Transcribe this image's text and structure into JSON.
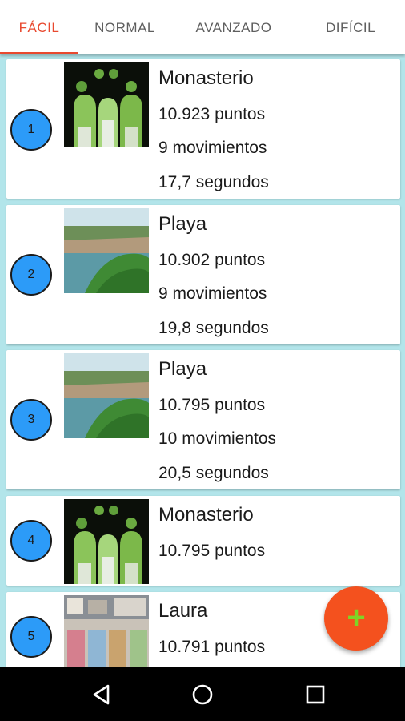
{
  "tabs": [
    {
      "label": "FÁCIL",
      "active": true
    },
    {
      "label": "NORMAL",
      "active": false
    },
    {
      "label": "AVANZADO",
      "active": false
    },
    {
      "label": "DIFÍCIL",
      "active": false
    }
  ],
  "colors": {
    "accent": "#e8492f",
    "rank_badge": "#2c9bf8",
    "fab": "#f4511e",
    "fab_icon": "#7fd426",
    "list_background": "#b2e5ea"
  },
  "scores": [
    {
      "rank": "1",
      "puzzle": "Monasterio",
      "image": "monastery",
      "points": "10.923 puntos",
      "moves": "9 movimientos",
      "time": "17,7 segundos"
    },
    {
      "rank": "2",
      "puzzle": "Playa",
      "image": "beach",
      "points": "10.902 puntos",
      "moves": "9 movimientos",
      "time": "19,8 segundos"
    },
    {
      "rank": "3",
      "puzzle": "Playa",
      "image": "beach",
      "points": "10.795 puntos",
      "moves": "10 movimientos",
      "time": "20,5 segundos"
    },
    {
      "rank": "4",
      "puzzle": "Monasterio",
      "image": "monastery",
      "points": "10.795 puntos"
    },
    {
      "rank": "5",
      "puzzle": "Laura",
      "image": "letters",
      "points": "10.791 puntos"
    }
  ],
  "fab": {
    "icon": "plus-icon",
    "symbol": "+"
  },
  "navigation": {
    "back_icon": "back-triangle-icon",
    "home_icon": "home-circle-icon",
    "recents_icon": "recents-square-icon"
  }
}
